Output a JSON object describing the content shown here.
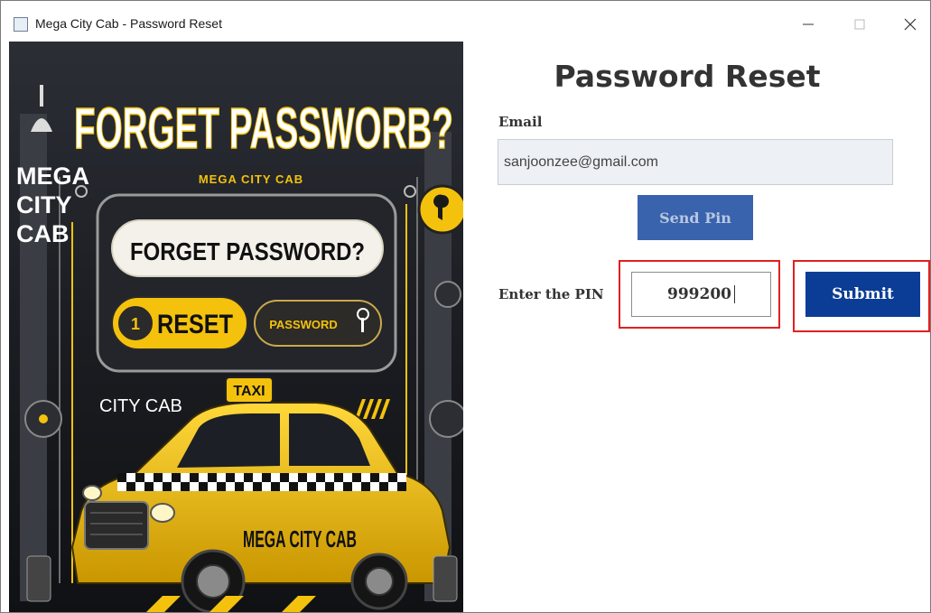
{
  "window": {
    "title": "Mega City Cab - Password Reset"
  },
  "hero": {
    "headline": "FORGET PASSWORB?",
    "brand_small": "MEGA CITY CAB",
    "side_brand": [
      "MEGA",
      "CITY",
      "CAB"
    ],
    "panel_text": "FORGET PASSWORD?",
    "reset_text": "RESET",
    "password_text": "PASSWORD",
    "city_cab_text": "CITY CAB",
    "taxi_sign": "TAXI",
    "door_text": "MEGA CITY CAB",
    "panel_badge": "1",
    "colors": {
      "yellow": "#f4c20d",
      "dark": "#1a1c21"
    }
  },
  "form": {
    "heading": "Password Reset",
    "email_label": "Email",
    "email_value": "sanjoonzee@gmail.com",
    "send_pin_label": "Send Pin",
    "pin_label": "Enter the PIN",
    "pin_value": "999200",
    "submit_label": "Submit",
    "colors": {
      "submit": "#0c3d96",
      "send_pin": "#3a63ad",
      "highlight": "#e02020"
    }
  }
}
